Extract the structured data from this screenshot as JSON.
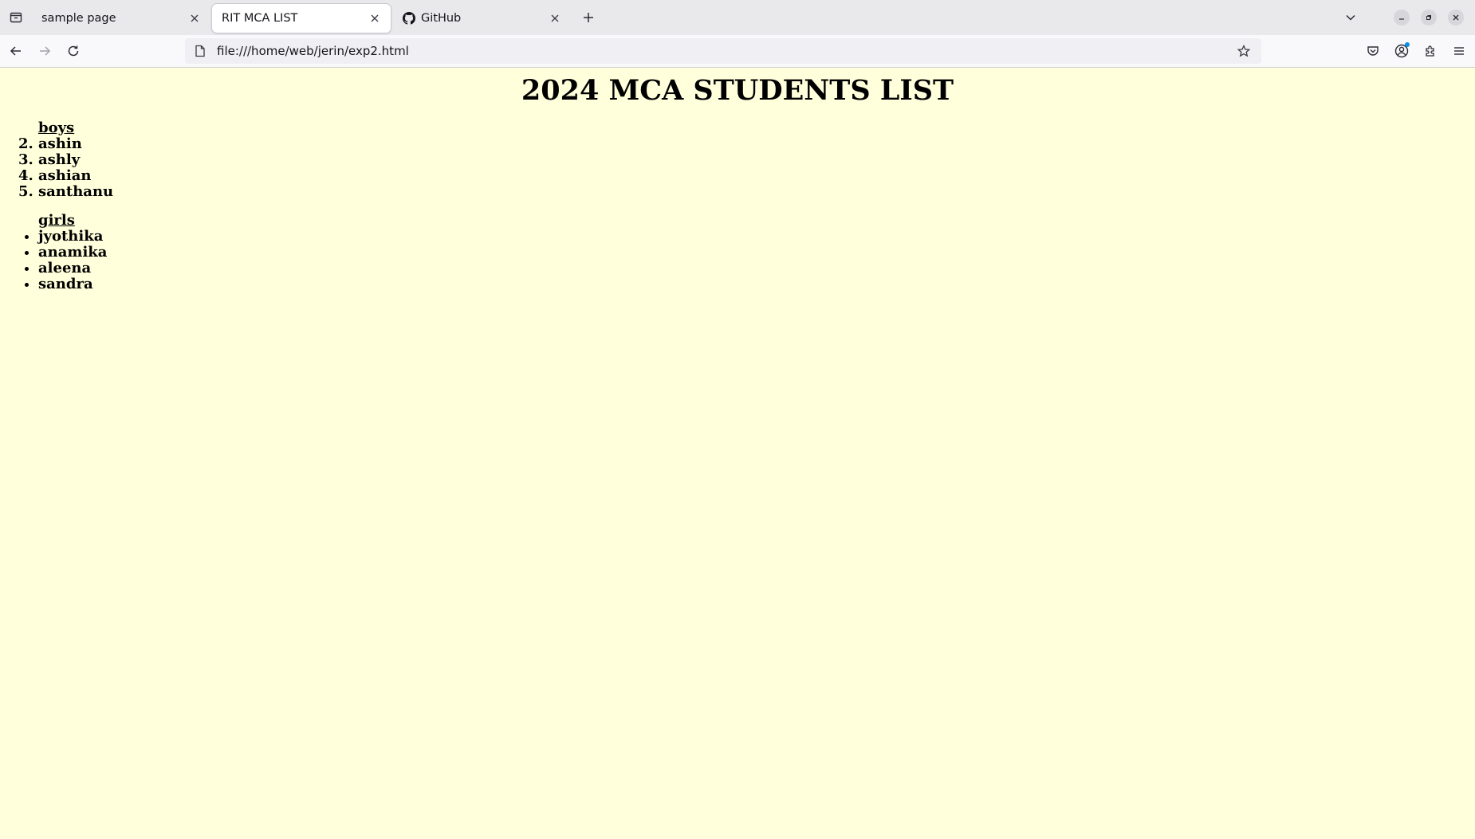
{
  "browser": {
    "tabs": [
      {
        "title": "sample page",
        "active": false,
        "icon": "none"
      },
      {
        "title": "RIT MCA LIST",
        "active": true,
        "icon": "none"
      },
      {
        "title": "GitHub",
        "active": false,
        "icon": "github-icon"
      }
    ],
    "url": "file:///home/web/jerin/exp2.html"
  },
  "page": {
    "background": "#ffffdc",
    "heading": "2024 MCA STUDENTS LIST",
    "boys": {
      "heading": "boys",
      "items": [
        "ashin",
        "ashly",
        "ashian",
        "santhanu"
      ]
    },
    "girls": {
      "heading": "girls",
      "items": [
        "jyothika",
        "anamika",
        "aleena",
        "sandra"
      ]
    }
  }
}
